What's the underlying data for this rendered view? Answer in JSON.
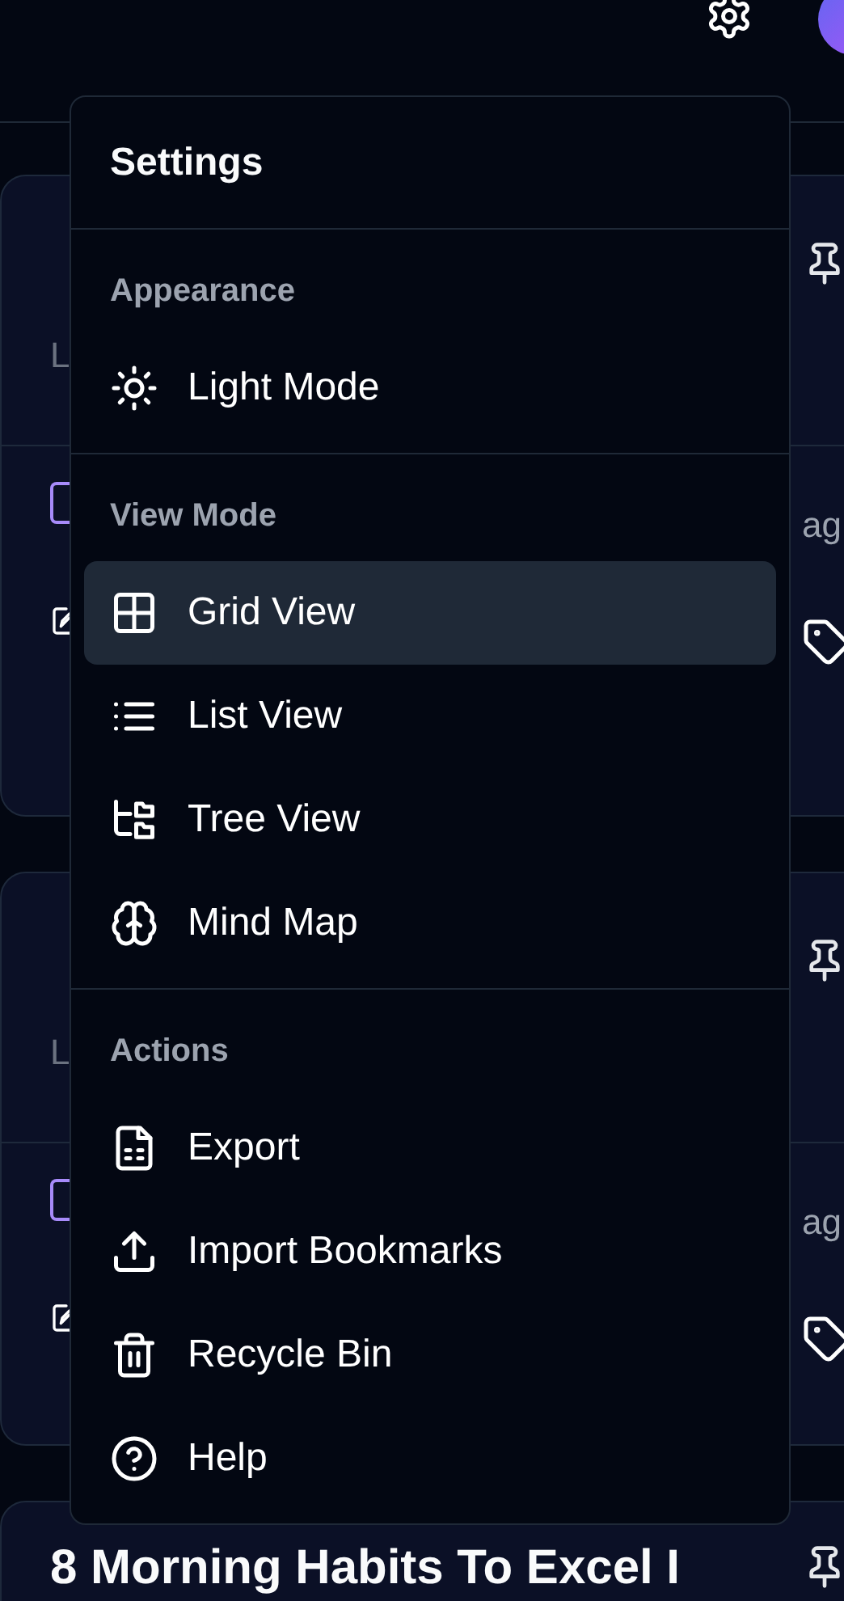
{
  "cards": [
    {
      "subtitle": "L",
      "time": "ag"
    },
    {
      "subtitle": "L",
      "time": "ag"
    },
    {
      "title": "8 Morning Habits To Excel I"
    }
  ],
  "settings_menu": {
    "title": "Settings",
    "sections": [
      {
        "label": "Appearance",
        "items": [
          {
            "label": "Light Mode",
            "selected": false
          }
        ]
      },
      {
        "label": "View Mode",
        "items": [
          {
            "label": "Grid View",
            "selected": true
          },
          {
            "label": "List View",
            "selected": false
          },
          {
            "label": "Tree View",
            "selected": false
          },
          {
            "label": "Mind Map",
            "selected": false
          }
        ]
      },
      {
        "label": "Actions",
        "items": [
          {
            "label": "Export",
            "selected": false
          },
          {
            "label": "Import Bookmarks",
            "selected": false
          },
          {
            "label": "Recycle Bin",
            "selected": false
          },
          {
            "label": "Help",
            "selected": false
          }
        ]
      }
    ]
  }
}
